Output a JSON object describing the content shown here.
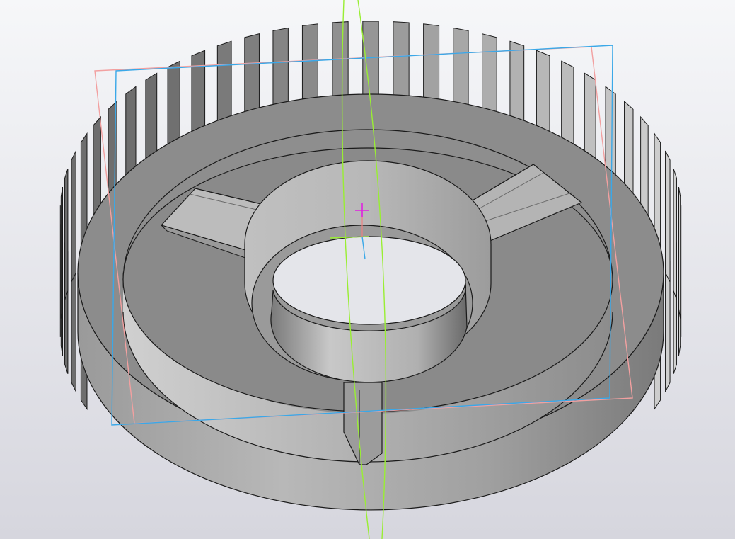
{
  "viewport": {
    "background_top": "#f6f7f9",
    "background_bottom": "#d6d6de"
  },
  "model": {
    "part": "timing-pulley",
    "tooth_count": 64,
    "spoke_count": 3,
    "body_color": "#8a8a8a",
    "hub_color": "#b4b4b4",
    "edge_color": "#1a1a1a"
  },
  "overlays": {
    "plane_colors": [
      "#f2a0a0",
      "#3aa8e8"
    ],
    "axis_color": "#99ee33",
    "origin_marker_color": "#e020e0"
  }
}
